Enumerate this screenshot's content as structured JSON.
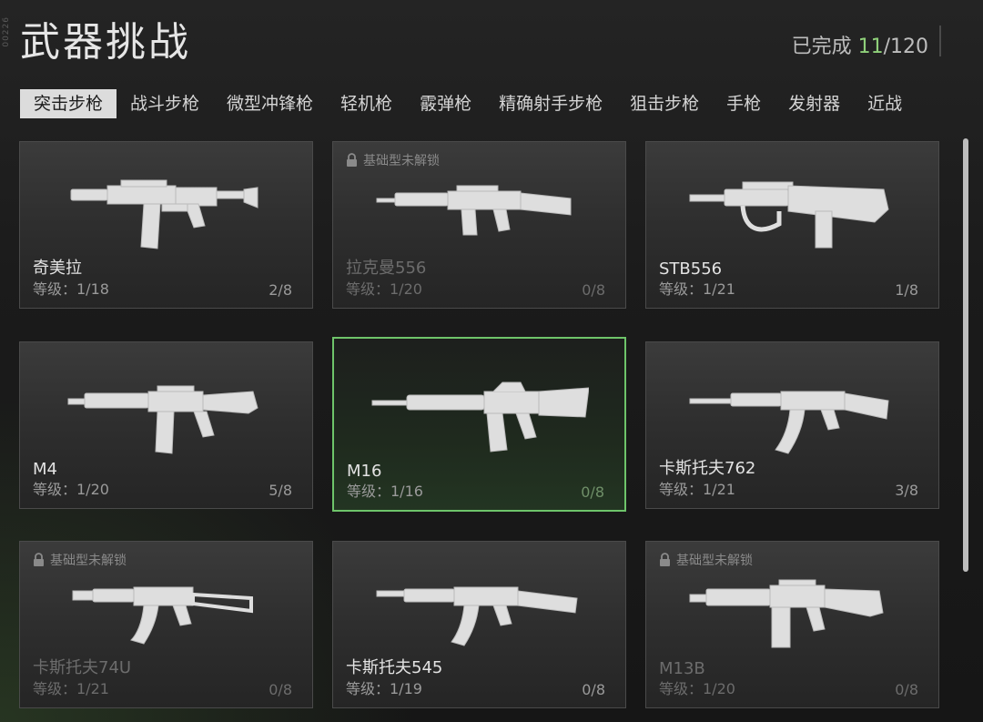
{
  "side_code": "00226",
  "header": {
    "title": "武器挑战",
    "progress_label": "已完成",
    "progress_done": "11",
    "progress_total": "/120"
  },
  "tabs": [
    {
      "label": "突击步枪",
      "active": true
    },
    {
      "label": "战斗步枪"
    },
    {
      "label": "微型冲锋枪"
    },
    {
      "label": "轻机枪"
    },
    {
      "label": "霰弹枪"
    },
    {
      "label": "精确射手步枪"
    },
    {
      "label": "狙击步枪"
    },
    {
      "label": "手枪"
    },
    {
      "label": "发射器"
    },
    {
      "label": "近战"
    }
  ],
  "locked_label": "基础型未解锁",
  "cards": [
    {
      "name": "奇美拉",
      "level": "等级：1/18",
      "count": "2/8",
      "locked": false,
      "selected": false,
      "icon": "chimera-rifle-icon"
    },
    {
      "name": "拉克曼556",
      "level": "等级：1/20",
      "count": "0/8",
      "locked": true,
      "selected": false,
      "icon": "lachmann-556-rifle-icon"
    },
    {
      "name": "STB556",
      "level": "等级：1/21",
      "count": "1/8",
      "locked": false,
      "selected": false,
      "icon": "stb556-rifle-icon"
    },
    {
      "name": "M4",
      "level": "等级：1/20",
      "count": "5/8",
      "locked": false,
      "selected": false,
      "icon": "m4-rifle-icon"
    },
    {
      "name": "M16",
      "level": "等级：1/16",
      "count": "0/8",
      "locked": false,
      "selected": true,
      "icon": "m16-rifle-icon"
    },
    {
      "name": "卡斯托夫762",
      "level": "等级：1/21",
      "count": "3/8",
      "locked": false,
      "selected": false,
      "icon": "kastov-762-rifle-icon"
    },
    {
      "name": "卡斯托夫74U",
      "level": "等级：1/21",
      "count": "0/8",
      "locked": true,
      "selected": false,
      "icon": "kastov-74u-rifle-icon"
    },
    {
      "name": "卡斯托夫545",
      "level": "等级：1/19",
      "count": "0/8",
      "locked": false,
      "selected": false,
      "icon": "kastov-545-rifle-icon"
    },
    {
      "name": "M13B",
      "level": "等级：1/20",
      "count": "0/8",
      "locked": true,
      "selected": false,
      "icon": "m13b-rifle-icon"
    }
  ],
  "colors": {
    "accent_green": "#8fd07a",
    "selected_border": "#6ec46a",
    "tab_active_bg": "#dcdcdc"
  }
}
